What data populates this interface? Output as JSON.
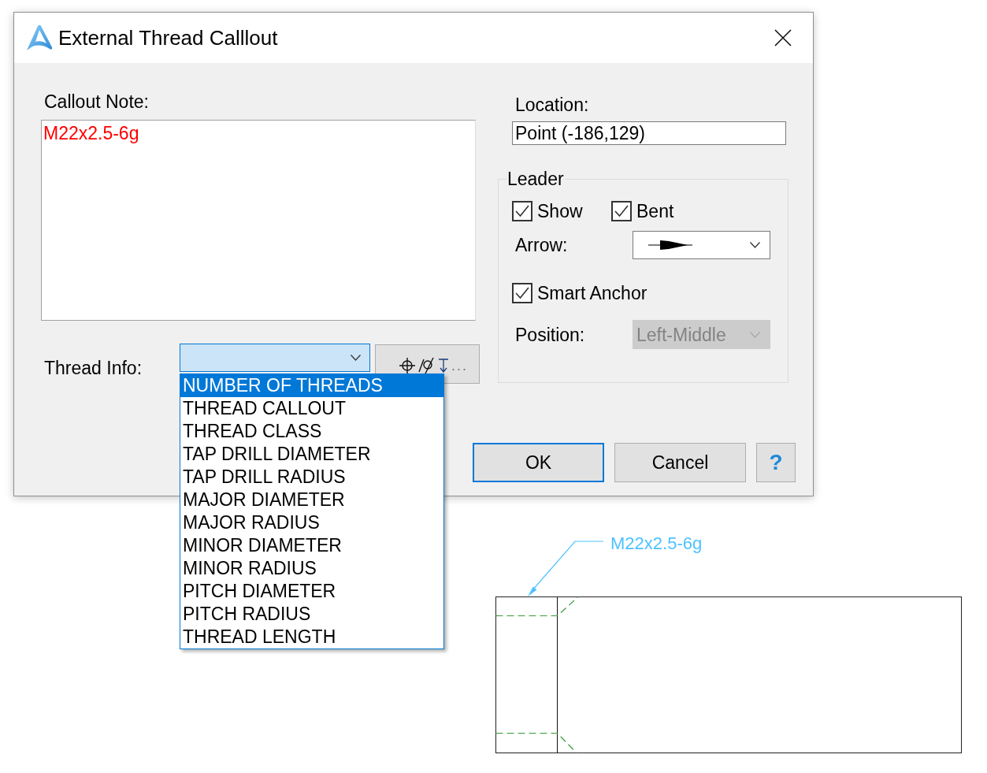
{
  "window": {
    "title": "External Thread Calllout"
  },
  "callout_note": {
    "label": "Callout Note:",
    "value": "M22x2.5-6g"
  },
  "thread_info": {
    "label": "Thread Info:",
    "dropdown": {
      "expanded": true,
      "options": [
        {
          "label": "NUMBER OF THREADS",
          "selected": true
        },
        {
          "label": "THREAD CALLOUT",
          "selected": false
        },
        {
          "label": "THREAD CLASS",
          "selected": false
        },
        {
          "label": "TAP DRILL DIAMETER",
          "selected": false
        },
        {
          "label": "TAP DRILL RADIUS",
          "selected": false
        },
        {
          "label": "MAJOR DIAMETER",
          "selected": false
        },
        {
          "label": "MAJOR RADIUS",
          "selected": false
        },
        {
          "label": "MINOR DIAMETER",
          "selected": false
        },
        {
          "label": "MINOR RADIUS",
          "selected": false
        },
        {
          "label": "PITCH DIAMETER",
          "selected": false
        },
        {
          "label": "PITCH RADIUS",
          "selected": false
        },
        {
          "label": "THREAD LENGTH",
          "selected": false
        }
      ]
    },
    "symbols_button": {
      "label": "..."
    }
  },
  "location": {
    "label": "Location:",
    "value": "Point (-186,129)"
  },
  "leader": {
    "title": "Leader",
    "checkboxes": [
      {
        "label": "Show",
        "checked": true
      },
      {
        "label": "Bent",
        "checked": true
      }
    ],
    "arrow": {
      "label": "Arrow:"
    },
    "smart_anchor": {
      "label": "Smart Anchor",
      "checked": true
    },
    "position": {
      "label": "Position:",
      "value": "Left-Middle",
      "disabled": true
    }
  },
  "buttons": [
    {
      "label": "OK",
      "kind": "default"
    },
    {
      "label": "Cancel",
      "kind": "normal"
    },
    {
      "label": "?",
      "kind": "help"
    }
  ],
  "drawing": {
    "callout_text": "M22x2.5-6g"
  }
}
